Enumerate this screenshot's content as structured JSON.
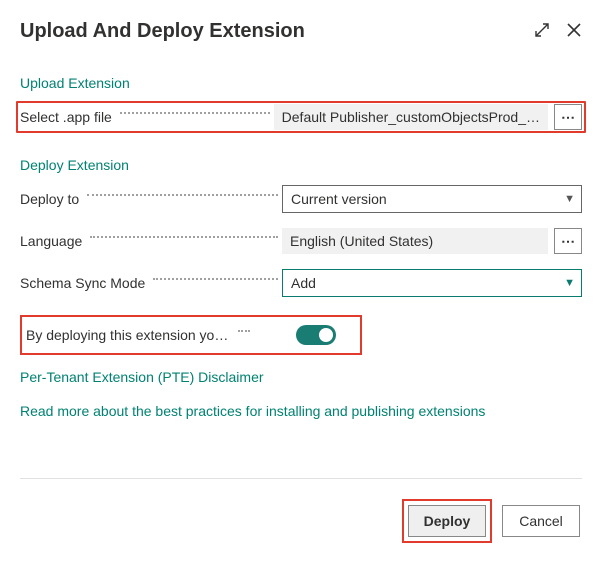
{
  "title": "Upload And Deploy Extension",
  "sections": {
    "upload": "Upload Extension",
    "deploy": "Deploy Extension"
  },
  "rows": {
    "selectFile": {
      "label": "Select .app file",
      "value": "Default Publisher_customObjectsProd_…"
    },
    "deployTo": {
      "label": "Deploy to",
      "value": "Current version"
    },
    "language": {
      "label": "Language",
      "value": "English (United States)"
    },
    "schema": {
      "label": "Schema Sync Mode",
      "value": "Add"
    },
    "consent": {
      "label": "By deploying this extension yo…"
    }
  },
  "links": {
    "pte": "Per-Tenant Extension (PTE) Disclaimer",
    "best": "Read more about the best practices for installing and publishing extensions"
  },
  "buttons": {
    "deploy": "Deploy",
    "cancel": "Cancel",
    "more": "⋯"
  }
}
